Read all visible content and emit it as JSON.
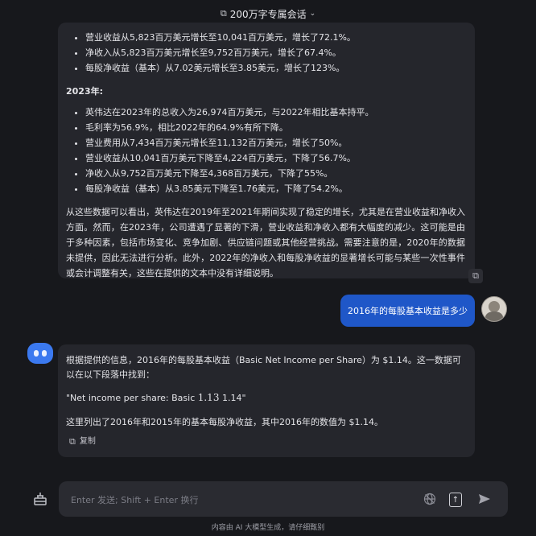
{
  "header": {
    "title": "200万字专属会话",
    "share_icon": "external-link-icon",
    "dropdown_icon": "chevron-down-icon"
  },
  "assistant_msg_1": {
    "bullets_2022": [
      "营业收益从5,823百万美元增长至10,041百万美元，增长了72.1%。",
      "净收入从5,823百万美元增长至9,752百万美元，增长了67.4%。",
      "每股净收益（基本）从7.02美元增长至3.85美元，增长了123%。"
    ],
    "section_2023": "2023年:",
    "bullets_2023": [
      "英伟达在2023年的总收入为26,974百万美元，与2022年相比基本持平。",
      "毛利率为56.9%，相比2022年的64.9%有所下降。",
      "营业费用从7,434百万美元增长至11,132百万美元，增长了50%。",
      "营业收益从10,041百万美元下降至4,224百万美元，下降了56.7%。",
      "净收入从9,752百万美元下降至4,368百万美元，下降了55%。",
      "每股净收益（基本）从3.85美元下降至1.76美元，下降了54.2%。"
    ],
    "conclusion": "从这些数据可以看出，英伟达在2019年至2021年期间实现了稳定的增长，尤其是在营业收益和净收入方面。然而，在2023年，公司遭遇了显著的下滑，营业收益和净收入都有大幅度的减少。这可能是由于多种因素，包括市场变化、竞争加剧、供应链问题或其他经营挑战。需要注意的是，2020年的数据未提供，因此无法进行分析。此外，2022年的净收入和每股净收益的显著增长可能与某些一次性事件或会计调整有关，这些在提供的文本中没有详细说明。"
  },
  "user_msg": {
    "text": "2016年的每股基本收益是多少"
  },
  "assistant_msg_2": {
    "line1": "根据提供的信息，2016年的每股基本收益（Basic Net Income per Share）为 $1.14。这一数据可以在以下段落中找到：",
    "quote_prefix": "\"Net income per share: Basic ",
    "quote_mono": "1.13",
    "quote_suffix": " 1.14\"",
    "summary": "这里列出了2016年和2015年的基本每股净收益，其中2016年的数值为 $1.14。",
    "copy_label": "复制"
  },
  "composer": {
    "placeholder": "Enter 发送; Shift + Enter 换行"
  },
  "footer": {
    "disclaimer": "内容由 AI 大模型生成，请仔细甄别"
  },
  "colors": {
    "background": "#17181c",
    "card": "#25262c",
    "user_bubble": "#1f57c8",
    "bot_avatar": "#3b79ef"
  }
}
